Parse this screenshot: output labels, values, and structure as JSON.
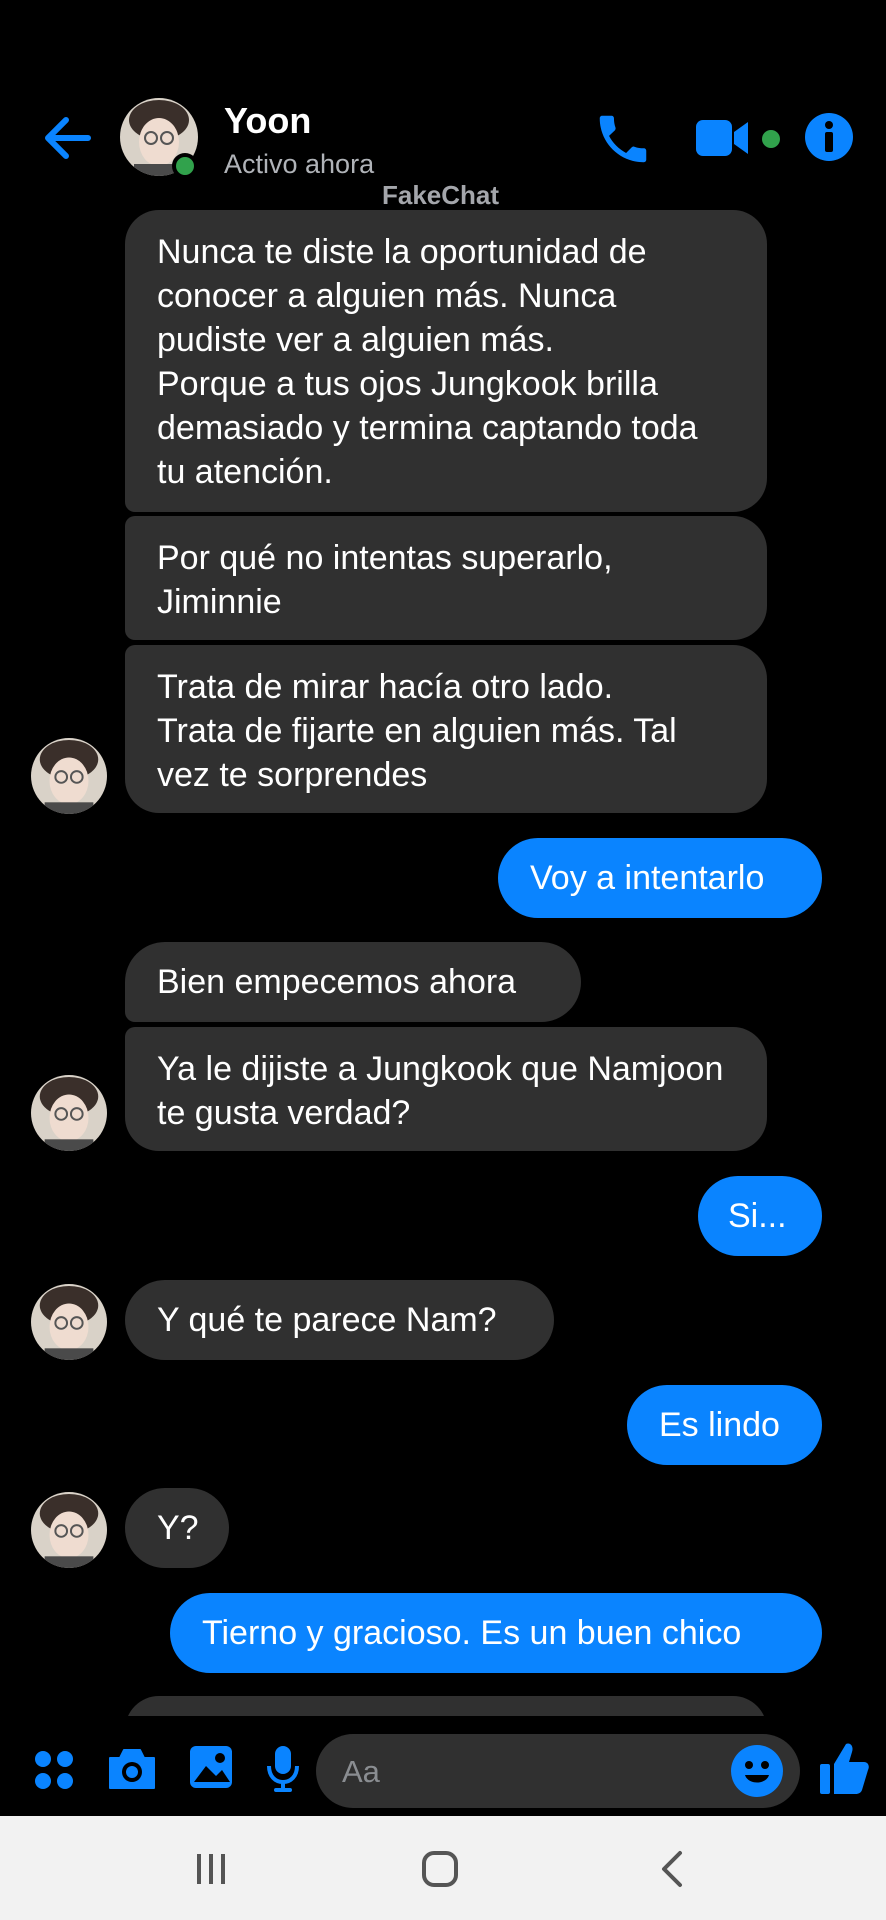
{
  "header": {
    "contact_name": "Yoon",
    "status": "Activo ahora",
    "watermark": "FakeChat",
    "icons": [
      "back-arrow-icon",
      "phone-icon",
      "video-camera-icon",
      "info-icon"
    ]
  },
  "messages": [
    {
      "from": "them",
      "text": "Nunca te diste la oportunidad de conocer a alguien más. Nunca pudiste ver a alguien más.\nPorque a tus ojos Jungkook brilla demasiado y termina captando toda tu atención."
    },
    {
      "from": "them",
      "text": "Por qué no intentas superarlo, Jiminnie"
    },
    {
      "from": "them",
      "text": "Trata de mirar hacía otro lado.\nTrata de fijarte en alguien más. Tal vez te sorprendes"
    },
    {
      "from": "me",
      "text": "Voy a intentarlo"
    },
    {
      "from": "them",
      "text": "Bien empecemos ahora"
    },
    {
      "from": "them",
      "text": "Ya le dijiste a Jungkook que Namjoon te gusta verdad?"
    },
    {
      "from": "me",
      "text": "Si..."
    },
    {
      "from": "them",
      "text": "Y qué te parece Nam?"
    },
    {
      "from": "me",
      "text": "Es lindo"
    },
    {
      "from": "them",
      "text": "Y?"
    },
    {
      "from": "me",
      "text": "Tierno y gracioso. Es un buen chico"
    }
  ],
  "composer": {
    "placeholder": "Aa",
    "icons": [
      "apps-icon",
      "camera-icon",
      "image-icon",
      "microphone-icon",
      "emoji-icon",
      "thumbs-up-icon"
    ]
  },
  "navigation": {
    "icons": [
      "recent-apps-icon",
      "home-icon",
      "back-icon"
    ]
  },
  "colors": {
    "background": "#000000",
    "accent": "#0a84ff",
    "incoming_bubble": "#303030",
    "online": "#31a24c"
  }
}
